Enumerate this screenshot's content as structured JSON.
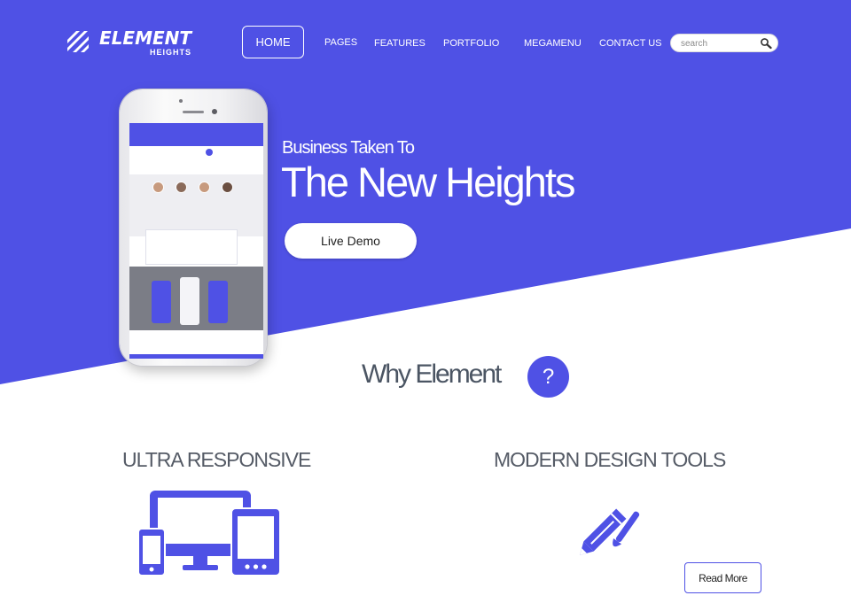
{
  "colors": {
    "accent": "#4f51e5",
    "text_dark": "#4b5563",
    "white": "#ffffff"
  },
  "logo": {
    "name": "ELEMENT",
    "sub": "HEIGHTS",
    "icon": "stripes-logo-icon"
  },
  "nav": {
    "home": "HOME",
    "pages": "PAGES",
    "features": "FEATURES",
    "portfolio": "PORTFOLIO",
    "megamenu": "MEGAMENU",
    "contact": "CONTACT US"
  },
  "search": {
    "placeholder": "search",
    "icon": "search-icon"
  },
  "hero": {
    "subtitle": "Business Taken To",
    "title": "The New Heights",
    "cta": "Live Demo"
  },
  "why": {
    "title": "Why Element",
    "badge": "?"
  },
  "features": [
    {
      "title": "ULTRA RESPONSIVE",
      "icon": "devices-icon"
    },
    {
      "title": "MODERN DESIGN TOOLS",
      "icon": "pencil-brush-icon"
    }
  ],
  "read_more": "Read More"
}
